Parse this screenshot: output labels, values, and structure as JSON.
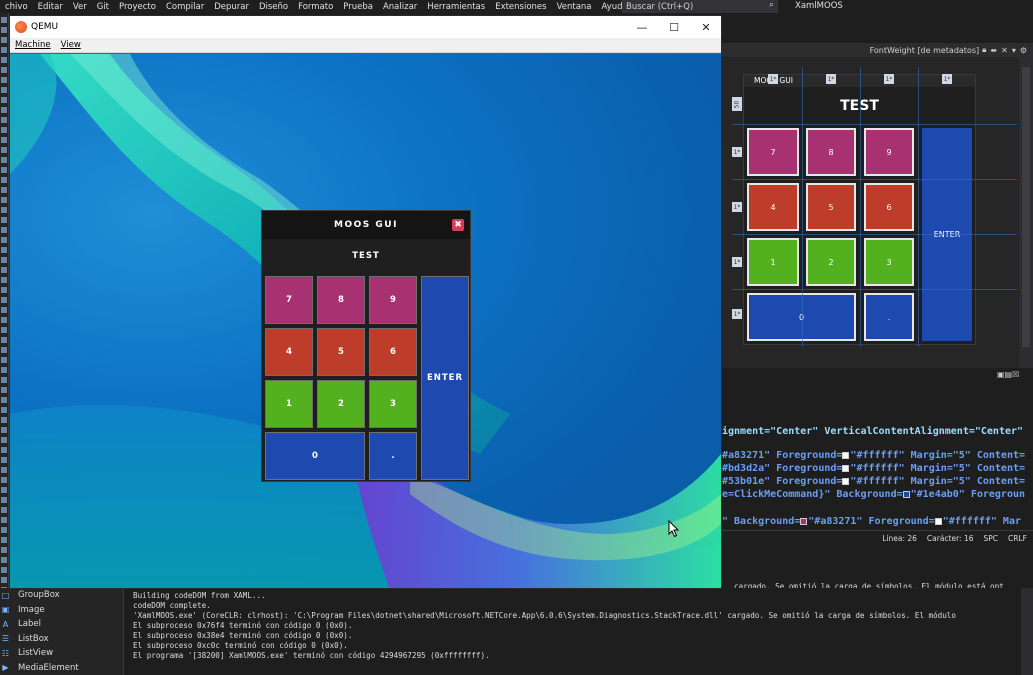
{
  "vs": {
    "menu": [
      "chivo",
      "Editar",
      "Ver",
      "Git",
      "Proyecto",
      "Compilar",
      "Depurar",
      "Diseño",
      "Formato",
      "Prueba",
      "Analizar",
      "Herramientas",
      "Extensiones",
      "Ventana",
      "Ayuda"
    ],
    "search_placeholder": "Buscar (Ctrl+Q)",
    "solution_title": "XamlMOOS",
    "property_tab": "FontWeight [de metadatos]",
    "designer_zoom_label": "50",
    "designer_col_labels": [
      "1*",
      "1*",
      "1*",
      "1*"
    ],
    "designer_row_labels": [
      "1*",
      "1*",
      "1*",
      "1*"
    ]
  },
  "colors": {
    "purple": "#a83271",
    "red": "#bd3d2a",
    "green": "#53b01e",
    "blue": "#1e4ab0"
  },
  "qemu": {
    "title": "QEMU",
    "menu_machine": "Machine",
    "menu_view": "View",
    "minimize_glyph": "—",
    "maximize_glyph": "☐",
    "close_glyph": "✕"
  },
  "moos": {
    "title": "MOOS GUI",
    "display": "TEST",
    "close_glyph": "✖",
    "keys": {
      "k7": "7",
      "k8": "8",
      "k9": "9",
      "k4": "4",
      "k5": "5",
      "k6": "6",
      "k1": "1",
      "k2": "2",
      "k3": "3",
      "k0": "0",
      "dot": ".",
      "enter": "ENTER"
    }
  },
  "designer": {
    "title": "MOOS GUI",
    "display": "TEST",
    "enter": "ENTER"
  },
  "code": {
    "line1": "ignment=\"Center\" VerticalContentAlignment=\"Center\"",
    "line2_pre": "#a83271\" Foreground=",
    "line2_val": "\"#ffffff\" Margin=\"5\" Content=",
    "line3_pre": "#bd3d2a\" Foreground=",
    "line3_val": "\"#ffffff\" Margin=\"5\" Content=",
    "line4_pre": "#53b01e\" Foreground=",
    "line4_val": "\"#ffffff\" Margin=\"5\" Content=",
    "line5_a": "e=ClickMeCommand}\" Background=",
    "line5_b": "\"#1e4ab0\" Foregroun",
    "line6_a": "\" Background=",
    "line6_b": "\"#a83271\" Foreground=",
    "line6_c": "\"#ffffff\" Mar",
    "status_line": "Línea: 26",
    "status_char": "Carácter: 16",
    "status_spc": "SPC",
    "status_crlf": "CRLF"
  },
  "toolbox": {
    "items": [
      {
        "icon": "groupbox-icon",
        "label": "GroupBox"
      },
      {
        "icon": "image-icon",
        "label": "Image"
      },
      {
        "icon": "label-icon",
        "label": "Label"
      },
      {
        "icon": "listbox-icon",
        "label": "ListBox"
      },
      {
        "icon": "listview-icon",
        "label": "ListView"
      },
      {
        "icon": "mediaelement-icon",
        "label": "MediaElement"
      }
    ]
  },
  "output": {
    "top_right": "cargado. Se omitió la carga de símbolos. El módulo está opt",
    "lines": [
      "Building codeDOM from XAML...",
      "codeDOM complete.",
      "'XamlMOOS.exe' (CoreCLR: clrhost): 'C:\\Program Files\\dotnet\\shared\\Microsoft.NETCore.App\\6.0.6\\System.Diagnostics.StackTrace.dll' cargado. Se omitió la carga de símbolos. El módulo",
      "El subproceso 0x76f4 terminó con código 0 (0x0).",
      "El subproceso 0x38e4 terminó con código 0 (0x0).",
      "El subproceso 0xc0c terminó con código 0 (0x0).",
      "El programa '[38200] XamlMOOS.exe' terminó con código 4294967295 (0xffffffff)."
    ]
  }
}
